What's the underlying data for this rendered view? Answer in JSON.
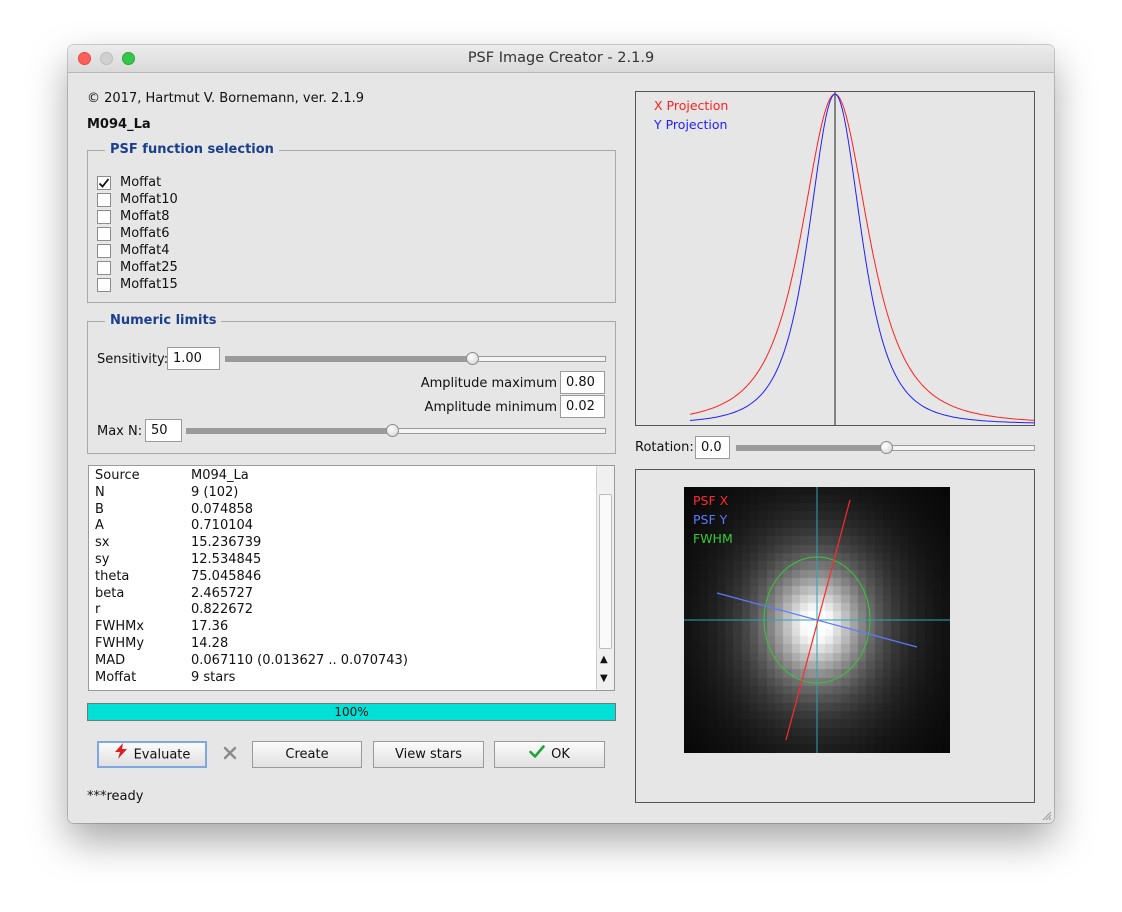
{
  "window": {
    "title": "PSF Image Creator - 2.1.9"
  },
  "copyright": "© 2017, Hartmut V. Bornemann, ver. 2.1.9",
  "source_name": "M094_La",
  "psf_selection": {
    "legend": "PSF function selection",
    "options": [
      {
        "label": "Moffat",
        "checked": true
      },
      {
        "label": "Moffat10",
        "checked": false
      },
      {
        "label": "Moffat8",
        "checked": false
      },
      {
        "label": "Moffat6",
        "checked": false
      },
      {
        "label": "Moffat4",
        "checked": false
      },
      {
        "label": "Moffat25",
        "checked": false
      },
      {
        "label": "Moffat15",
        "checked": false
      }
    ]
  },
  "numeric_limits": {
    "legend": "Numeric limits",
    "sensitivity_label": "Sensitivity:",
    "sensitivity_value": "1.00",
    "sensitivity_slider_fraction": 0.65,
    "amp_max_label": "Amplitude maximum",
    "amp_max_value": "0.80",
    "amp_min_label": "Amplitude minimum",
    "amp_min_value": "0.02",
    "maxn_label": "Max N:",
    "maxn_value": "50",
    "maxn_slider_fraction": 0.49
  },
  "results": [
    {
      "key": "Source",
      "value": "M094_La"
    },
    {
      "key": "N",
      "value": "9 (102)"
    },
    {
      "key": "B",
      "value": "0.074858"
    },
    {
      "key": "A",
      "value": "0.710104"
    },
    {
      "key": "sx",
      "value": "15.236739"
    },
    {
      "key": "sy",
      "value": "12.534845"
    },
    {
      "key": "theta",
      "value": "75.045846"
    },
    {
      "key": "beta",
      "value": "2.465727"
    },
    {
      "key": "r",
      "value": "0.822672"
    },
    {
      "key": "FWHMx",
      "value": "17.36"
    },
    {
      "key": "FWHMy",
      "value": "14.28"
    },
    {
      "key": "MAD",
      "value": "0.067110 (0.013627 .. 0.070743)"
    },
    {
      "key": "Moffat",
      "value": "9 stars"
    }
  ],
  "progress": {
    "percent": 100,
    "label": "100%"
  },
  "buttons": {
    "evaluate": "Evaluate",
    "create": "Create",
    "view_stars": "View stars",
    "ok": "OK"
  },
  "status": "***ready",
  "projection_plot": {
    "legend_x": "X Projection",
    "legend_y": "Y Projection",
    "x_color": "#ff2020",
    "y_color": "#2020ff"
  },
  "rotation": {
    "label": "Rotation:",
    "value": "0.0",
    "slider_fraction": 0.5
  },
  "psf_image": {
    "legend_x": "PSF X",
    "legend_y": "PSF Y",
    "legend_fwhm": "FWHM",
    "x_color": "#ff2a2a",
    "y_color": "#5a7bff",
    "fwhm_color": "#33cc33"
  }
}
